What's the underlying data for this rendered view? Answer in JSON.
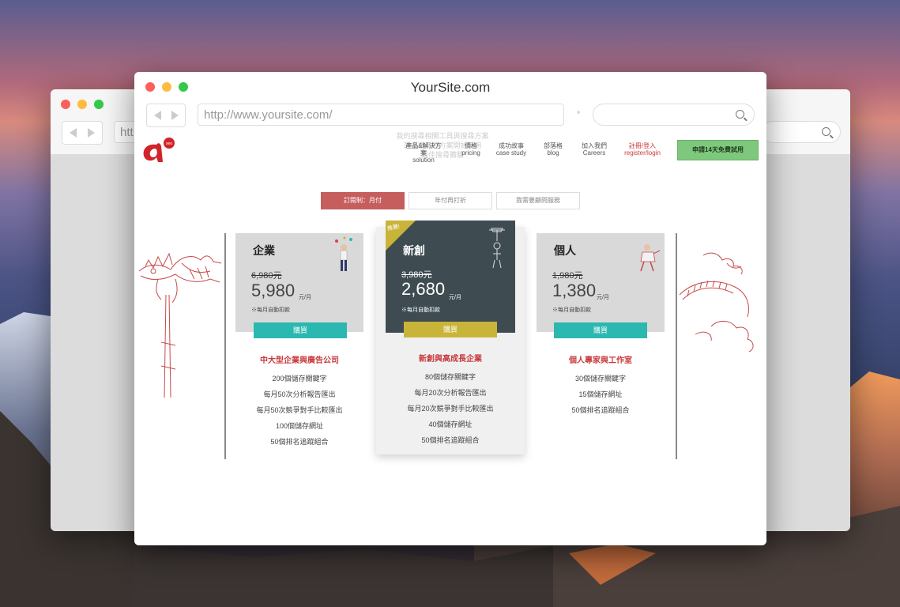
{
  "window": {
    "title": "YourSite.com"
  },
  "back_window": {
    "url_partial": "htt"
  },
  "browser": {
    "url": "http://www.yoursite.com/",
    "search_placeholder": ""
  },
  "site": {
    "faded_lines": [
      "我的搜尋相關工具與搜尋方案",
      "選擇適合的方案開始使用",
      "最佳搜尋體驗"
    ],
    "nav": [
      {
        "label": "產品&解決方案",
        "sub": "solution"
      },
      {
        "label": "價格",
        "sub": "pricing"
      },
      {
        "label": "成功故事",
        "sub": "case study"
      },
      {
        "label": "部落格",
        "sub": "blog"
      },
      {
        "label": "加入我們",
        "sub": "Careers"
      },
      {
        "label": "註冊/登入",
        "sub": "register/login"
      }
    ],
    "trial_button": "申請14天免費試用",
    "tabs": [
      "訂閱制：月付",
      "年付再打折",
      "我需要顧問服務"
    ],
    "plans": [
      {
        "name": "企業",
        "old_price": "6,980元",
        "price": "5,980",
        "unit": "元/月",
        "note": "※每月自動扣款",
        "buy": "購買",
        "subtitle": "中大型企業與廣告公司",
        "features": [
          "200個儲存關鍵字",
          "每月50次分析報告匯出",
          "每月50次競爭對手比較匯出",
          "100個儲存網址",
          "50個排名追蹤組合"
        ]
      },
      {
        "name": "新創",
        "badge": "推薦!",
        "old_price": "3,980元",
        "price": "2,680",
        "unit": "元/月",
        "note": "※每月自動扣款",
        "buy": "購買",
        "subtitle": "新創與高成長企業",
        "features": [
          "80個儲存關鍵字",
          "每月20次分析報告匯出",
          "每月20次競爭對手比較匯出",
          "40個儲存網址",
          "50個排名追蹤組合"
        ]
      },
      {
        "name": "個人",
        "old_price": "1,980元",
        "price": "1,380",
        "unit": "元/月",
        "note": "※每月自動扣款",
        "buy": "購買",
        "subtitle": "個人專家與工作室",
        "features": [
          "30個儲存關鍵字",
          "15個儲存網址",
          "50個排名追蹤組合"
        ]
      }
    ]
  },
  "colors": {
    "accent_red": "#c8393b",
    "teal": "#2bb8b0",
    "gold": "#c9b43a",
    "dark_card": "#3e4c52",
    "trial_green": "#7ec87e"
  }
}
